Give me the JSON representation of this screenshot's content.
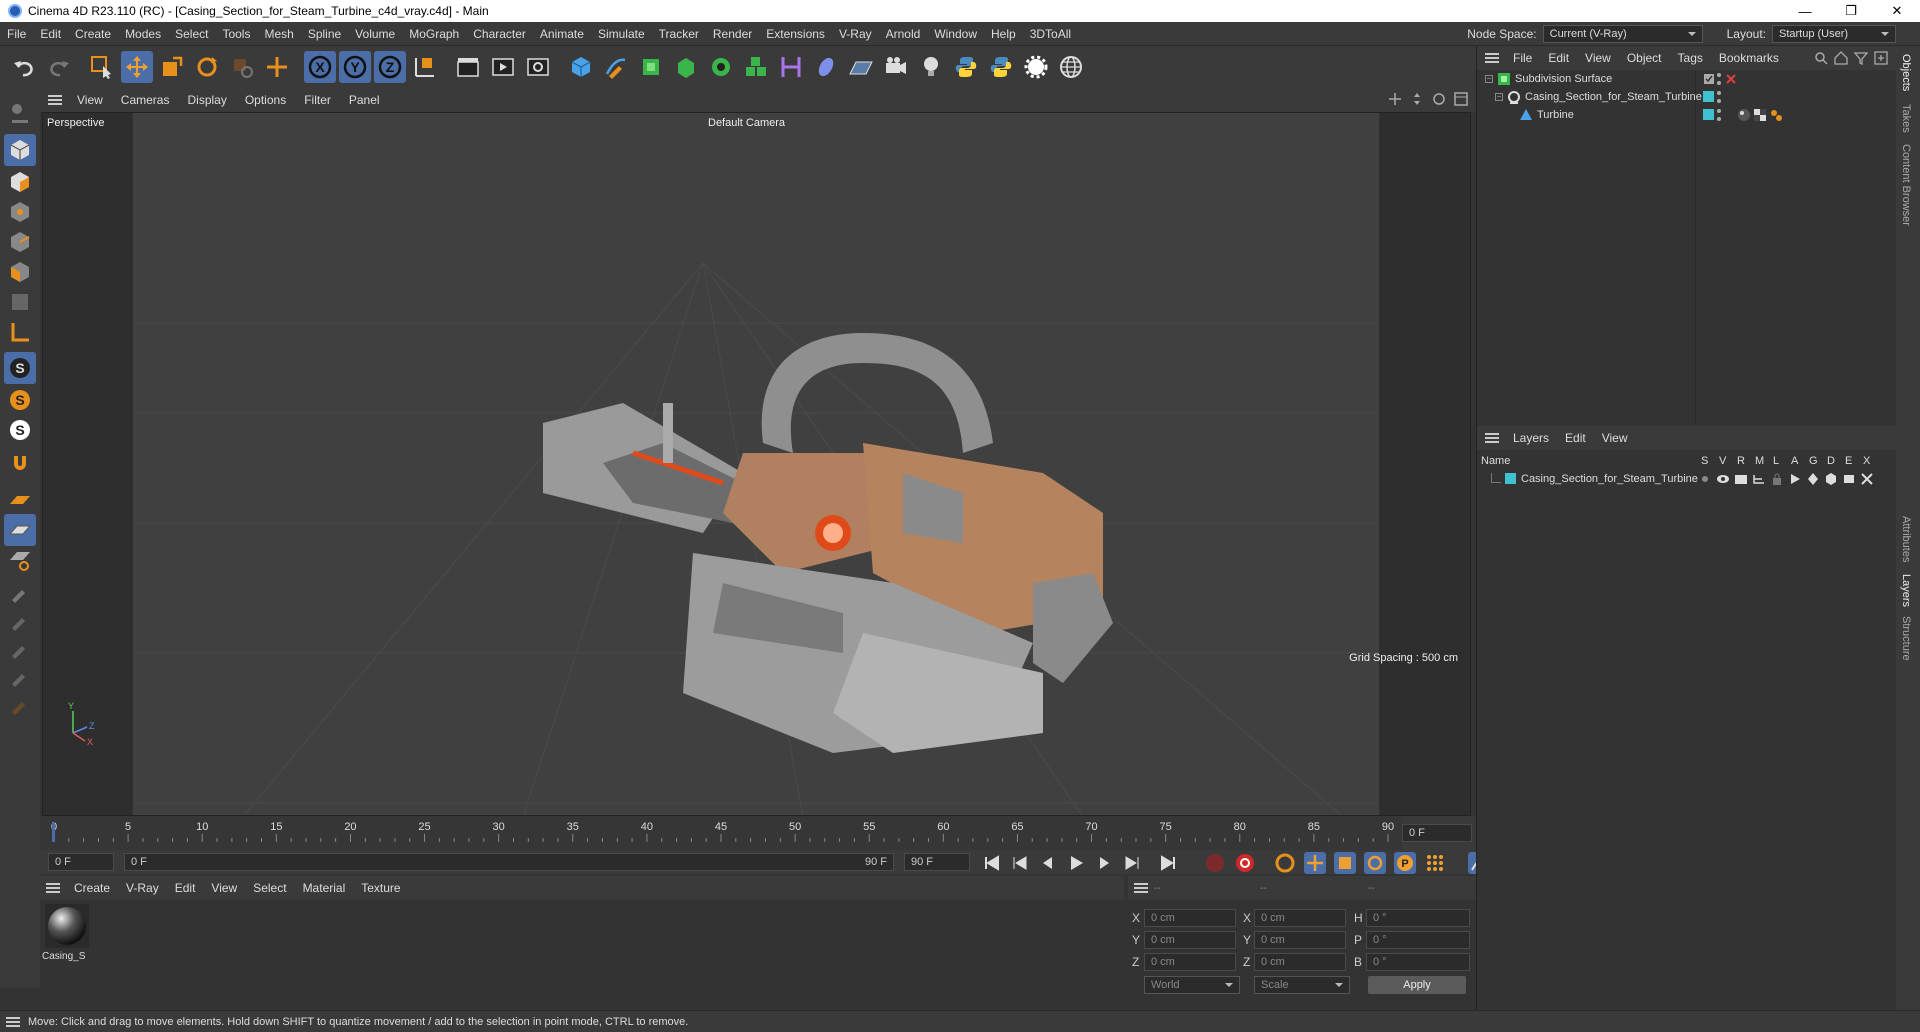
{
  "window": {
    "title": "Cinema 4D R23.110 (RC) - [Casing_Section_for_Steam_Turbine_c4d_vray.c4d] - Main"
  },
  "menu": [
    "File",
    "Edit",
    "Create",
    "Modes",
    "Select",
    "Tools",
    "Mesh",
    "Spline",
    "Volume",
    "MoGraph",
    "Character",
    "Animate",
    "Simulate",
    "Tracker",
    "Render",
    "Extensions",
    "V-Ray",
    "Arnold",
    "Window",
    "Help",
    "3DToAll"
  ],
  "nodespace": {
    "label": "Node Space:",
    "value": "Current (V-Ray)"
  },
  "layout": {
    "label": "Layout:",
    "value": "Startup (User)"
  },
  "viewport": {
    "menu": [
      "View",
      "Cameras",
      "Display",
      "Options",
      "Filter",
      "Panel"
    ],
    "label": "Perspective",
    "camera": "Default Camera",
    "grid": "Grid Spacing : 500 cm",
    "axis": {
      "y": "Y",
      "z": "Z",
      "x": "X"
    }
  },
  "timeline": {
    "ticks": [
      "0",
      "5",
      "10",
      "15",
      "20",
      "25",
      "30",
      "35",
      "40",
      "45",
      "50",
      "55",
      "60",
      "65",
      "70",
      "75",
      "80",
      "85",
      "90"
    ],
    "current": "0 F",
    "start": "0 F",
    "range_start": "0 F",
    "range_end": "90 F",
    "end": "90 F"
  },
  "materials": {
    "menu": [
      "Create",
      "V-Ray",
      "Edit",
      "View",
      "Select",
      "Material",
      "Texture"
    ],
    "items": [
      {
        "name": "Casing_S"
      }
    ]
  },
  "coords": {
    "header": [
      "--",
      "--",
      "--"
    ],
    "rows": [
      {
        "a": "X",
        "av": "0 cm",
        "b": "X",
        "bv": "0 cm",
        "c": "H",
        "cv": "0 °"
      },
      {
        "a": "Y",
        "av": "0 cm",
        "b": "Y",
        "bv": "0 cm",
        "c": "P",
        "cv": "0 °"
      },
      {
        "a": "Z",
        "av": "0 cm",
        "b": "Z",
        "bv": "0 cm",
        "c": "B",
        "cv": "0 °"
      }
    ],
    "world": "World",
    "scale": "Scale",
    "apply": "Apply"
  },
  "objects": {
    "menu": [
      "File",
      "Edit",
      "View",
      "Object",
      "Tags",
      "Bookmarks"
    ],
    "items": [
      {
        "name": "Subdivision Surface"
      },
      {
        "name": "Casing_Section_for_Steam_Turbine"
      },
      {
        "name": "Turbine"
      }
    ]
  },
  "layers": {
    "menu": [
      "Layers",
      "Edit",
      "View"
    ],
    "header": {
      "name": "Name",
      "cols": [
        "S",
        "V",
        "R",
        "M",
        "L",
        "A",
        "G",
        "D",
        "E",
        "X"
      ]
    },
    "items": [
      {
        "name": "Casing_Section_for_Steam_Turbine"
      }
    ]
  },
  "side_tabs": [
    "Objects",
    "Takes",
    "Content Browser",
    "Attributes",
    "Layers",
    "Structure"
  ],
  "status": "Move: Click and drag to move elements. Hold down SHIFT to quantize movement / add to the selection in point mode, CTRL to remove.",
  "colors": {
    "accent": "#4b6ea8",
    "layer": "#3fc1d0",
    "orange": "#e8901c"
  }
}
